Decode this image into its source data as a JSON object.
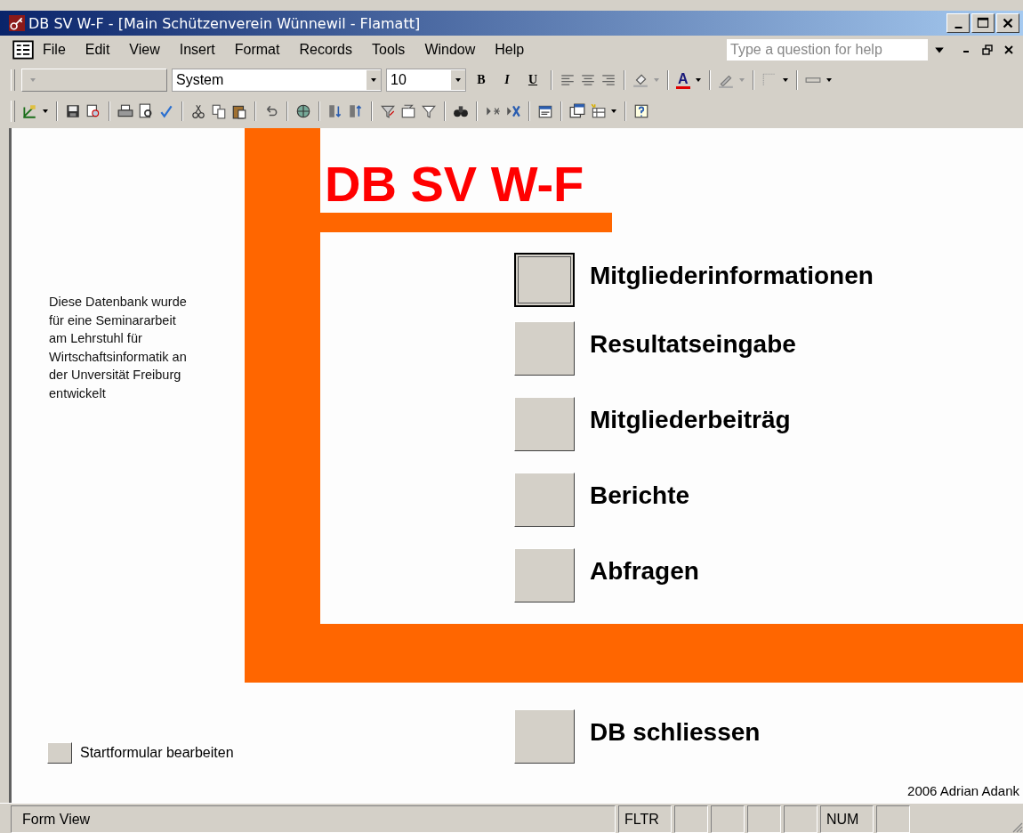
{
  "window": {
    "title": "DB SV W-F - [Main Schützenverein Wünnewil - Flamatt]"
  },
  "menu": [
    {
      "label": "File"
    },
    {
      "label": "Edit"
    },
    {
      "label": "View"
    },
    {
      "label": "Insert"
    },
    {
      "label": "Format"
    },
    {
      "label": "Records"
    },
    {
      "label": "Tools"
    },
    {
      "label": "Window"
    },
    {
      "label": "Help"
    }
  ],
  "help_box": {
    "placeholder": "Type a question for help"
  },
  "format_toolbar": {
    "font": "System",
    "size": "10",
    "style_buttons": [
      {
        "label": "B",
        "kind": "bold"
      },
      {
        "label": "I",
        "kind": "italic"
      },
      {
        "label": "U",
        "kind": "underline"
      }
    ],
    "font_color_label": "A"
  },
  "form": {
    "title": "DB SV W-F",
    "info": "Diese Datenbank wurde\nfür eine Seminararbeit\nam Lehrstuhl für\nWirtschaftsinformatik an\nder Unversität Freiburg\nentwickelt",
    "menu_buttons": [
      {
        "label": "Mitgliederinformationen",
        "focused": true
      },
      {
        "label": "Resultatseingabe",
        "focused": false
      },
      {
        "label": "Mitgliederbeiträg",
        "focused": false
      },
      {
        "label": "Berichte",
        "focused": false
      },
      {
        "label": "Abfragen",
        "focused": false
      }
    ],
    "close_button": {
      "label": "DB schliessen"
    },
    "edit_button": {
      "label": "Startformular bearbeiten"
    },
    "credit": "2006 Adrian Adank"
  },
  "status_bar": {
    "mode": "Form View",
    "panes": [
      {
        "text": "FLTR"
      },
      {
        "text": "NUM"
      }
    ]
  }
}
